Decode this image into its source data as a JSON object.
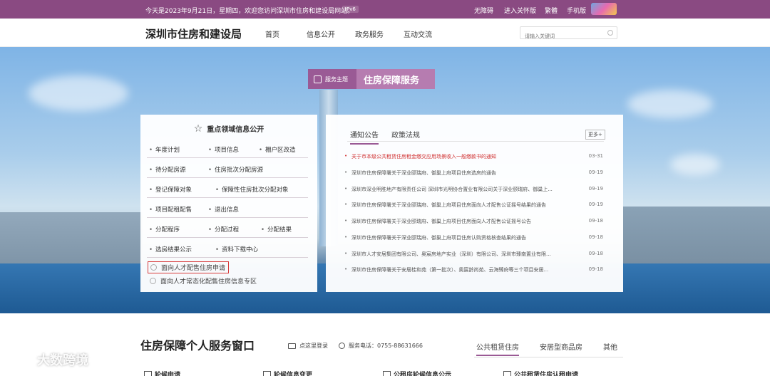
{
  "topbar": {
    "welcome": "今天是2023年9月21日，星期四，欢迎您访问深圳市住房和建设局网站。",
    "ipv6": "IPv6",
    "links": [
      "无障碍",
      "进入关怀版",
      "繁體",
      "手机版"
    ]
  },
  "header": {
    "site_name": "深圳市住房和建设局",
    "nav": [
      "首页",
      "信息公开",
      "政务服务",
      "互动交流"
    ],
    "search_placeholder": "请输入关键词"
  },
  "service_tag": {
    "label": "服务主题",
    "title": "住房保障服务"
  },
  "key_info": {
    "title": "重点领域信息公开",
    "rows": [
      [
        "年度计划",
        "项目信息",
        "棚户区改造"
      ],
      [
        "待分配房源",
        "住房批次分配房源"
      ],
      [
        "登记保障对象",
        "保障性住房批次分配对象"
      ],
      [
        "项目配租配售",
        "退出信息"
      ],
      [
        "分配程序",
        "分配过程",
        "分配结果"
      ],
      [
        "选房结果公示",
        "资料下载中心"
      ]
    ],
    "special_1": "面向人才配售住房申请",
    "special_2": "面向人才常态化配售住房信息专区"
  },
  "notices": {
    "tabs": [
      "通知公告",
      "政策法规"
    ],
    "more": "更多+",
    "items": [
      {
        "title": "关于市本级公共租赁住房租金缴交应用场景收入一般缴款书的通知",
        "date": "03-31"
      },
      {
        "title": "深圳市住房保障署关于深业颐瑞府、御巢上府项目住房选房的通告",
        "date": "09-19"
      },
      {
        "title": "深圳市深业明胜地产有限责任公司 深圳市光明协合置业有限公司关于深业颐瑞府、御巢上...",
        "date": "09-19"
      },
      {
        "title": "深圳市住房保障署关于深业颐瑞府、御巢上府项目住房面向人才配售公证摇号结果的通告",
        "date": "09-19"
      },
      {
        "title": "深圳市住房保障署关于深业颐瑞府、御巢上府项目住房面向人才配售公证摇号公告",
        "date": "09-18"
      },
      {
        "title": "深圳市住房保障署关于深业颐瑞府、御巢上府项目住房认购资格核查结果的通告",
        "date": "09-18"
      },
      {
        "title": "深圳市人才安居集团有限公司、奥宸房地产实业（深圳）有限公司、深圳市臻南置业有限...",
        "date": "09-18"
      },
      {
        "title": "深圳市住房保障署关于安居桂和苑（第一批次）、奥宸龄尚苑、云海臻府等三个项目安居...",
        "date": "09-18"
      }
    ]
  },
  "bottom": {
    "title": "住房保障个人服务窗口",
    "login": "点这里登录",
    "phone": "服务电话：0755-88631666",
    "tabs": [
      "公共租赁住房",
      "安居型商品房",
      "其他"
    ],
    "items": [
      "轮候申请",
      "轮候信息变更",
      "公租房轮候信息公示",
      "公共租赁住房认租申请"
    ]
  },
  "watermark": "大数跨境"
}
